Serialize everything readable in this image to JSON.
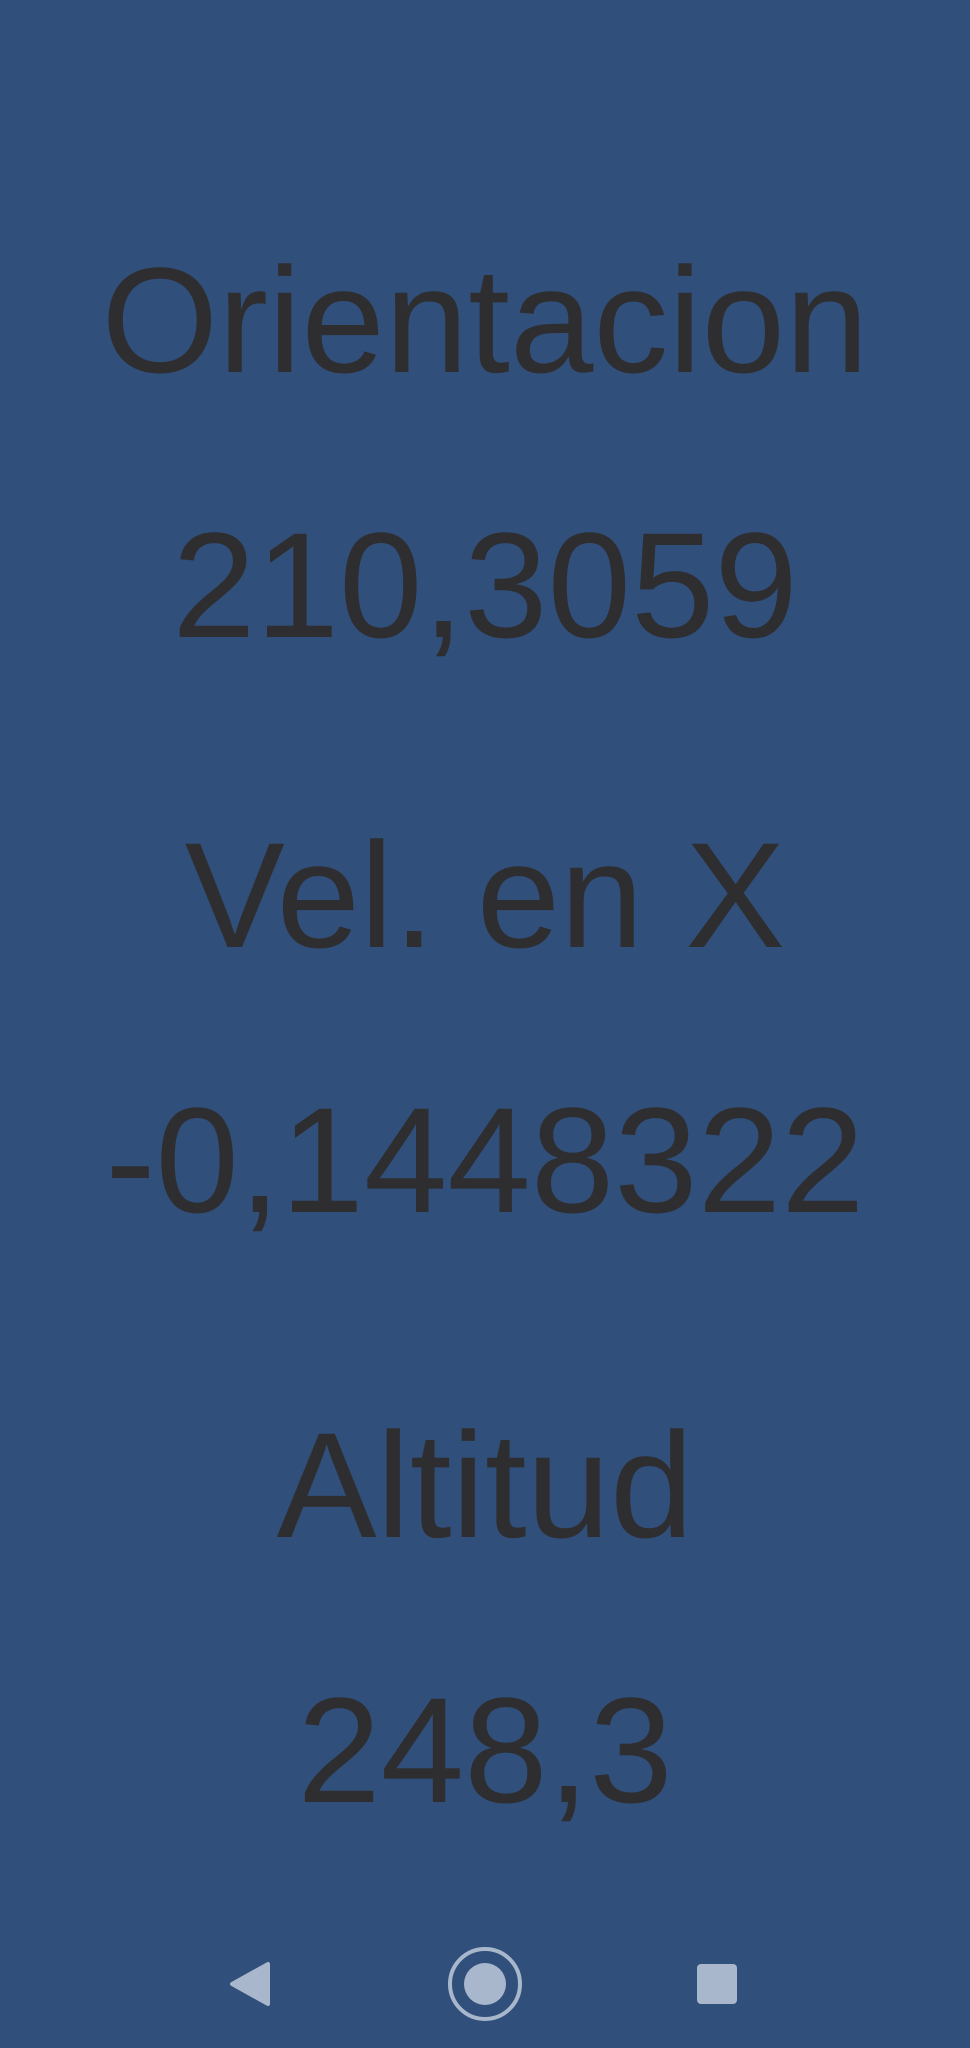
{
  "readouts": {
    "orientation_label": "Orientacion",
    "orientation_value": "210,3059",
    "velocity_x_label": "Vel. en X",
    "velocity_x_value": "-0,1448322",
    "altitude_label": "Altitud",
    "altitude_value": "248,3"
  },
  "nav_bar": {
    "back_icon": "triangle-left",
    "home_icon": "ring-with-dot",
    "recents_icon": "rounded-square"
  },
  "colors": {
    "background": "#314f7b",
    "text": "#2e2e30",
    "nav_icons": "#a9b7cd"
  }
}
